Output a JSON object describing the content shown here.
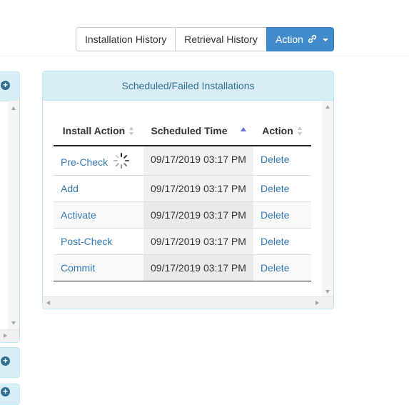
{
  "toolbar": {
    "installation_history_label": "Installation History",
    "retrieval_history_label": "Retrieval History",
    "action_label": "Action",
    "action_icon": "link-icon",
    "primary_color": "#428bca"
  },
  "left_panels": {
    "expand_icon": "plus-circle-icon"
  },
  "panel": {
    "title": "Scheduled/Failed Installations",
    "heading_color": "#31708f",
    "heading_bg": "#d9edf7",
    "columns": [
      "Install Action",
      "Scheduled Time",
      "Action"
    ],
    "sorted_column": "Scheduled Time",
    "sort_direction": "ascending",
    "rows": [
      {
        "install_action": "Pre-Check",
        "scheduled_time": "09/17/2019 03:17 PM",
        "action": "Delete",
        "loading": true
      },
      {
        "install_action": "Add",
        "scheduled_time": "09/17/2019 03:17 PM",
        "action": "Delete"
      },
      {
        "install_action": "Activate",
        "scheduled_time": "09/17/2019 03:17 PM",
        "action": "Delete"
      },
      {
        "install_action": "Post-Check",
        "scheduled_time": "09/17/2019 03:17 PM",
        "action": "Delete"
      },
      {
        "install_action": "Commit",
        "scheduled_time": "09/17/2019 03:17 PM",
        "action": "Delete"
      }
    ]
  }
}
